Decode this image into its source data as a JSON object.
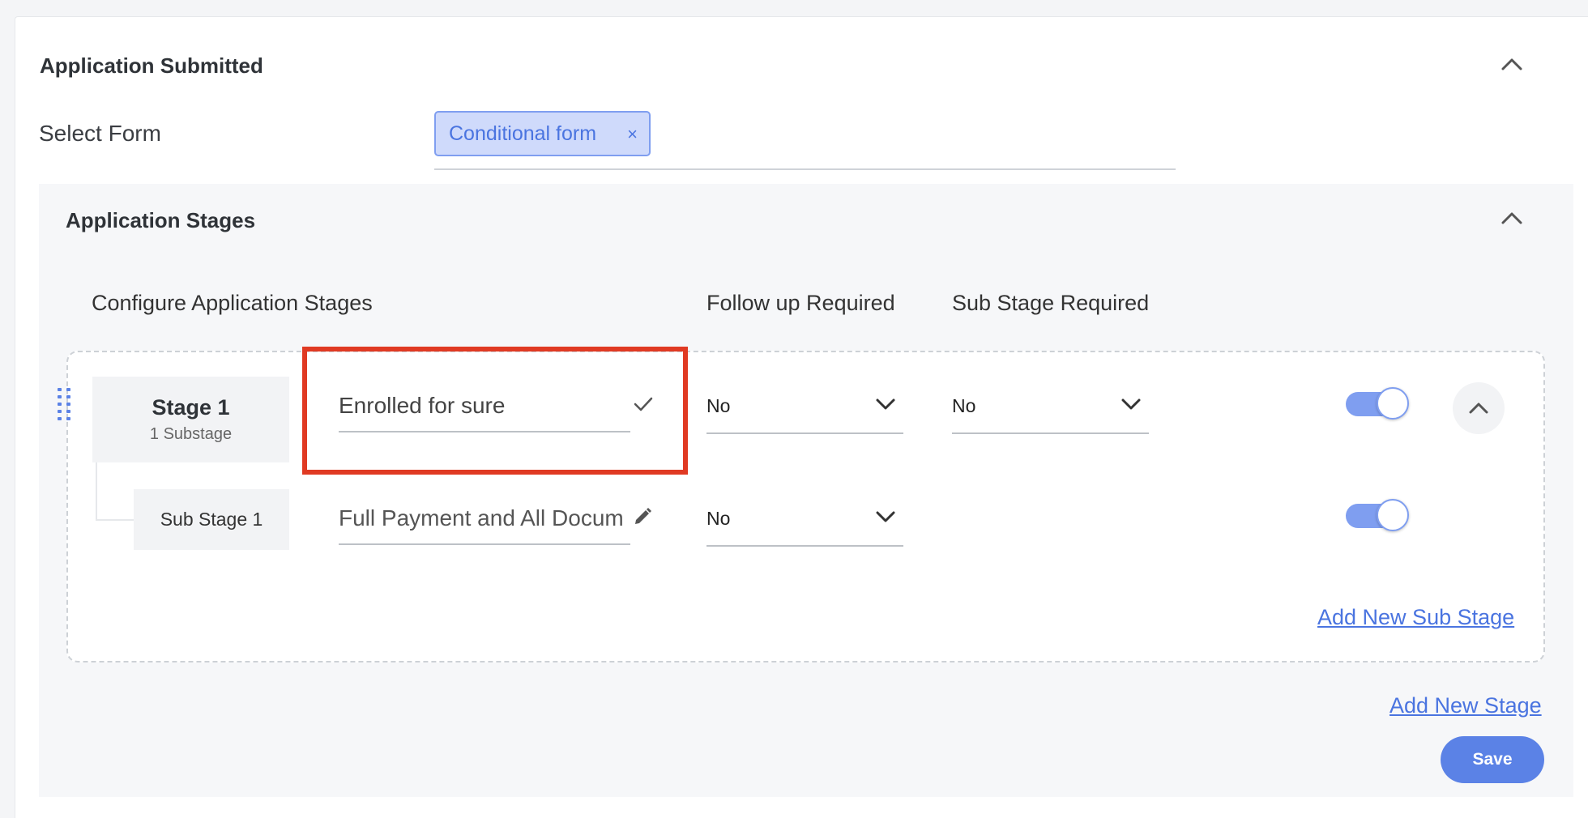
{
  "section": {
    "title": "Application Submitted",
    "select_form_label": "Select Form",
    "selected_form_chip": "Conditional form",
    "chip_remove_glyph": "×"
  },
  "stages": {
    "title": "Application Stages",
    "columns": {
      "configure": "Configure Application Stages",
      "follow_up": "Follow up Required",
      "sub_stage": "Sub Stage Required"
    },
    "stage": {
      "name": "Stage 1",
      "substage_count": "1 Substage",
      "input_value": "Enrolled for sure",
      "follow_up_value": "No",
      "sub_stage_value": "No",
      "enabled": true
    },
    "substage": {
      "name": "Sub Stage 1",
      "input_value": "Full Payment and All Docum",
      "follow_up_value": "No",
      "enabled": true
    },
    "add_sub_stage_label": "Add New Sub Stage",
    "add_stage_label": "Add New Stage",
    "save_label": "Save"
  },
  "colors": {
    "accent": "#5b82e6",
    "chip_bg": "#cfdafb",
    "highlight": "#e03a23"
  },
  "icons": [
    "chevron-up-icon",
    "close-icon",
    "drag-handle-icon",
    "check-icon",
    "pencil-icon",
    "chevron-down-icon"
  ]
}
